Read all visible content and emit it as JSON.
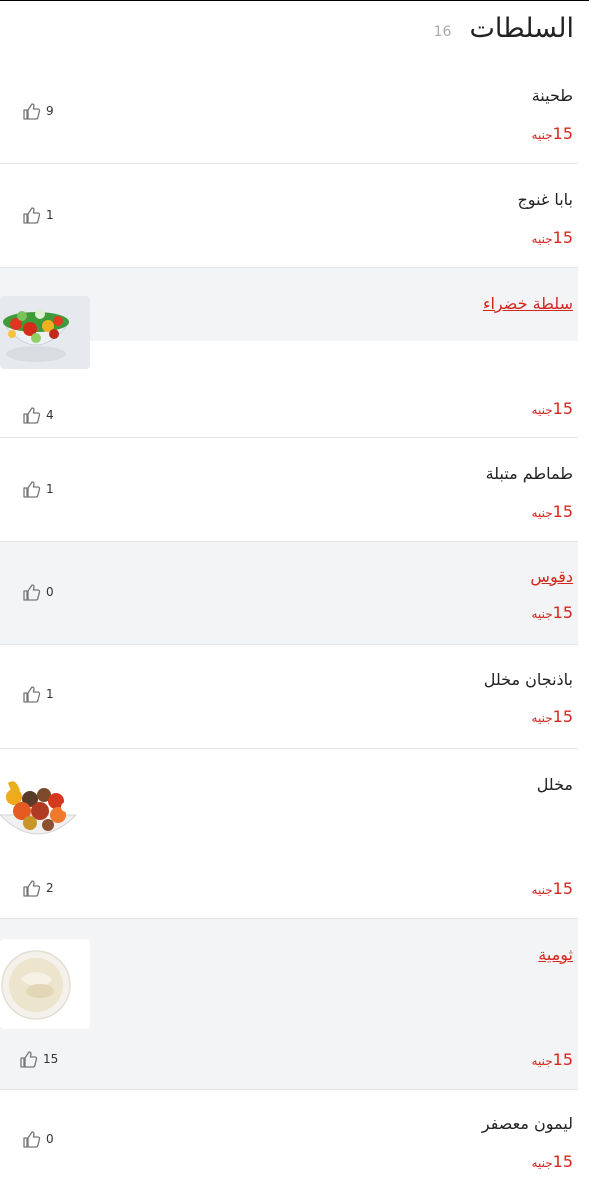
{
  "header": {
    "title": "السلطات",
    "count": "16"
  },
  "currency": "جنيه",
  "items": [
    {
      "name": "طحينة",
      "price": "15",
      "likes": "9"
    },
    {
      "name": "بابا غنوج",
      "price": "15",
      "likes": "1"
    },
    {
      "name": "سلطة خضراء",
      "price": "15",
      "likes": "4"
    },
    {
      "name": "طماطم متبلة",
      "price": "15",
      "likes": "1"
    },
    {
      "name": "دقوس",
      "price": "15",
      "likes": "0"
    },
    {
      "name": "باذنجان مخلل",
      "price": "15",
      "likes": "1"
    },
    {
      "name": "مخلل",
      "price": "15",
      "likes": "2"
    },
    {
      "name": "ثومية",
      "price": "15",
      "likes": "15"
    },
    {
      "name": "ليمون معصفر",
      "price": "15",
      "likes": "0"
    }
  ],
  "colors": {
    "accent": "#d7261e",
    "highlight_bg": "#f2f4f6",
    "divider": "#e3e3e3"
  }
}
